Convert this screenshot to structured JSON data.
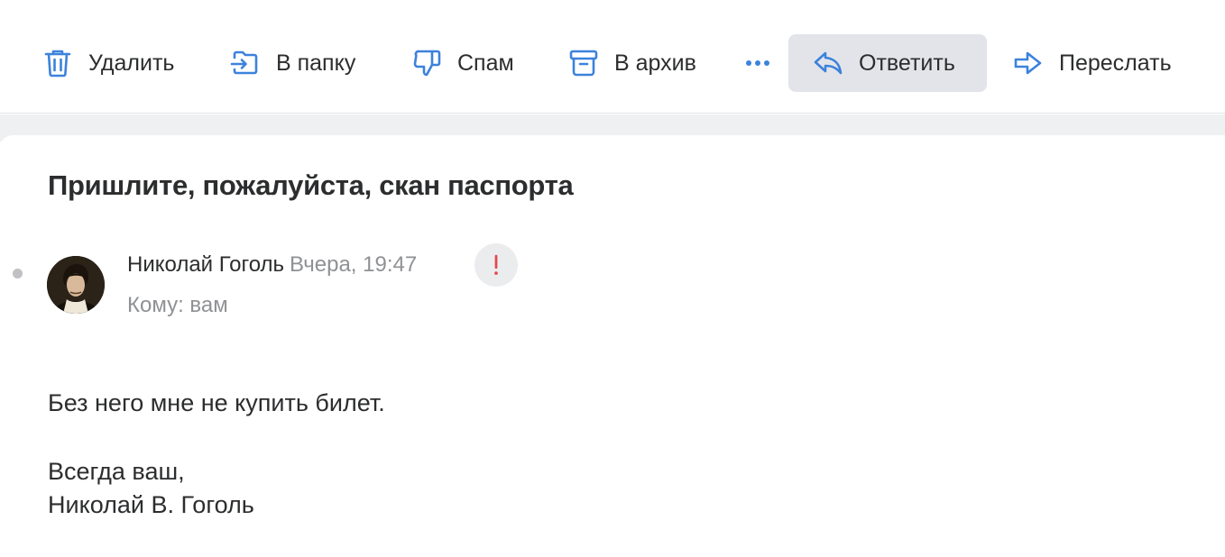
{
  "toolbar": {
    "delete_label": "Удалить",
    "move_label": "В папку",
    "spam_label": "Спам",
    "archive_label": "В архив",
    "reply_label": "Ответить",
    "forward_label": "Переслать"
  },
  "colors": {
    "accent": "#3c82dc",
    "importance_mark": "#e5484d",
    "active_button_bg": "#e3e4e9"
  },
  "icons": {
    "delete": "trash-icon",
    "move": "folder-move-icon",
    "spam": "thumbs-down-icon",
    "archive": "archive-box-icon",
    "more": "more-dots-icon",
    "reply": "reply-arrow-icon",
    "forward": "forward-arrow-icon",
    "importance": "exclamation-icon"
  },
  "message": {
    "subject": "Пришлите, пожалуйста, скан паспорта",
    "sender_name": "Николай Гоголь",
    "date": "Вчера, 19:47",
    "to": "Кому: вам",
    "body": {
      "line1": "Без него мне не купить билет.",
      "line2": "Всегда ваш,",
      "line3": "Николай В. Гоголь"
    }
  }
}
